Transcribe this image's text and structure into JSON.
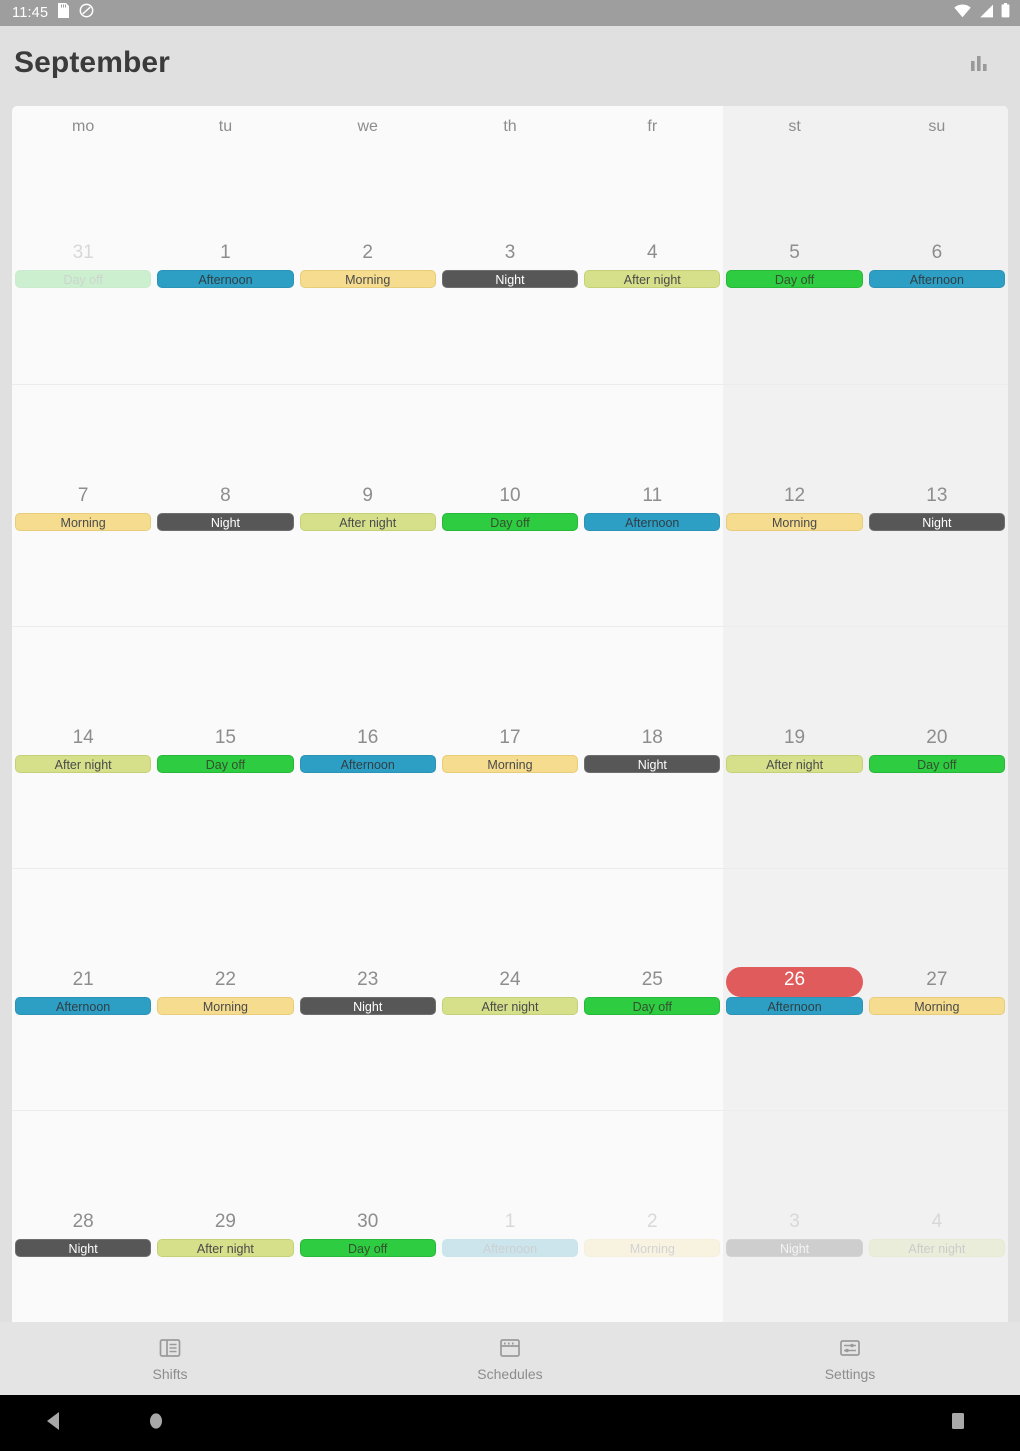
{
  "statusbar": {
    "time": "11:45",
    "icons": [
      "sd-card-icon",
      "do-not-disturb-icon"
    ],
    "right_icons": [
      "wifi-icon",
      "cell-signal-icon",
      "battery-icon"
    ]
  },
  "appbar": {
    "title": "September",
    "action_icon": "bar-chart-icon"
  },
  "calendar": {
    "day_headers": [
      "mo",
      "tu",
      "we",
      "th",
      "fr",
      "st",
      "su"
    ],
    "weekend_start_index": 5,
    "shift_colors": {
      "Morning": "#f5dc8e",
      "Afternoon": "#2e9fc4",
      "Night": "#575757",
      "After night": "#d6e08a",
      "Day off": "#2ecc40",
      "today_highlight": "#e05b5b"
    },
    "weeks": [
      [
        {
          "day": "31",
          "shift": "Day off",
          "class": "dayoff",
          "other": true,
          "today": false
        },
        {
          "day": "1",
          "shift": "Afternoon",
          "class": "afternoon",
          "other": false,
          "today": false
        },
        {
          "day": "2",
          "shift": "Morning",
          "class": "morning",
          "other": false,
          "today": false
        },
        {
          "day": "3",
          "shift": "Night",
          "class": "night",
          "other": false,
          "today": false
        },
        {
          "day": "4",
          "shift": "After night",
          "class": "afternight",
          "other": false,
          "today": false
        },
        {
          "day": "5",
          "shift": "Day off",
          "class": "dayoff",
          "other": false,
          "today": false
        },
        {
          "day": "6",
          "shift": "Afternoon",
          "class": "afternoon",
          "other": false,
          "today": false
        }
      ],
      [
        {
          "day": "7",
          "shift": "Morning",
          "class": "morning",
          "other": false,
          "today": false
        },
        {
          "day": "8",
          "shift": "Night",
          "class": "night",
          "other": false,
          "today": false
        },
        {
          "day": "9",
          "shift": "After night",
          "class": "afternight",
          "other": false,
          "today": false
        },
        {
          "day": "10",
          "shift": "Day off",
          "class": "dayoff",
          "other": false,
          "today": false
        },
        {
          "day": "11",
          "shift": "Afternoon",
          "class": "afternoon",
          "other": false,
          "today": false
        },
        {
          "day": "12",
          "shift": "Morning",
          "class": "morning",
          "other": false,
          "today": false
        },
        {
          "day": "13",
          "shift": "Night",
          "class": "night",
          "other": false,
          "today": false
        }
      ],
      [
        {
          "day": "14",
          "shift": "After night",
          "class": "afternight",
          "other": false,
          "today": false
        },
        {
          "day": "15",
          "shift": "Day off",
          "class": "dayoff",
          "other": false,
          "today": false
        },
        {
          "day": "16",
          "shift": "Afternoon",
          "class": "afternoon",
          "other": false,
          "today": false
        },
        {
          "day": "17",
          "shift": "Morning",
          "class": "morning",
          "other": false,
          "today": false
        },
        {
          "day": "18",
          "shift": "Night",
          "class": "night",
          "other": false,
          "today": false
        },
        {
          "day": "19",
          "shift": "After night",
          "class": "afternight",
          "other": false,
          "today": false
        },
        {
          "day": "20",
          "shift": "Day off",
          "class": "dayoff",
          "other": false,
          "today": false
        }
      ],
      [
        {
          "day": "21",
          "shift": "Afternoon",
          "class": "afternoon",
          "other": false,
          "today": false
        },
        {
          "day": "22",
          "shift": "Morning",
          "class": "morning",
          "other": false,
          "today": false
        },
        {
          "day": "23",
          "shift": "Night",
          "class": "night",
          "other": false,
          "today": false
        },
        {
          "day": "24",
          "shift": "After night",
          "class": "afternight",
          "other": false,
          "today": false
        },
        {
          "day": "25",
          "shift": "Day off",
          "class": "dayoff",
          "other": false,
          "today": false
        },
        {
          "day": "26",
          "shift": "Afternoon",
          "class": "afternoon",
          "other": false,
          "today": true
        },
        {
          "day": "27",
          "shift": "Morning",
          "class": "morning",
          "other": false,
          "today": false
        }
      ],
      [
        {
          "day": "28",
          "shift": "Night",
          "class": "night",
          "other": false,
          "today": false
        },
        {
          "day": "29",
          "shift": "After night",
          "class": "afternight",
          "other": false,
          "today": false
        },
        {
          "day": "30",
          "shift": "Day off",
          "class": "dayoff",
          "other": false,
          "today": false
        },
        {
          "day": "1",
          "shift": "Afternoon",
          "class": "afternoon",
          "other": true,
          "today": false
        },
        {
          "day": "2",
          "shift": "Morning",
          "class": "morning",
          "other": true,
          "today": false
        },
        {
          "day": "3",
          "shift": "Night",
          "class": "night",
          "other": true,
          "today": false
        },
        {
          "day": "4",
          "shift": "After night",
          "class": "afternight",
          "other": true,
          "today": false
        }
      ]
    ]
  },
  "bottomnav": {
    "items": [
      {
        "label": "Shifts",
        "icon": "shifts-icon"
      },
      {
        "label": "Schedules",
        "icon": "calendar-icon"
      },
      {
        "label": "Settings",
        "icon": "sliders-icon"
      }
    ]
  }
}
